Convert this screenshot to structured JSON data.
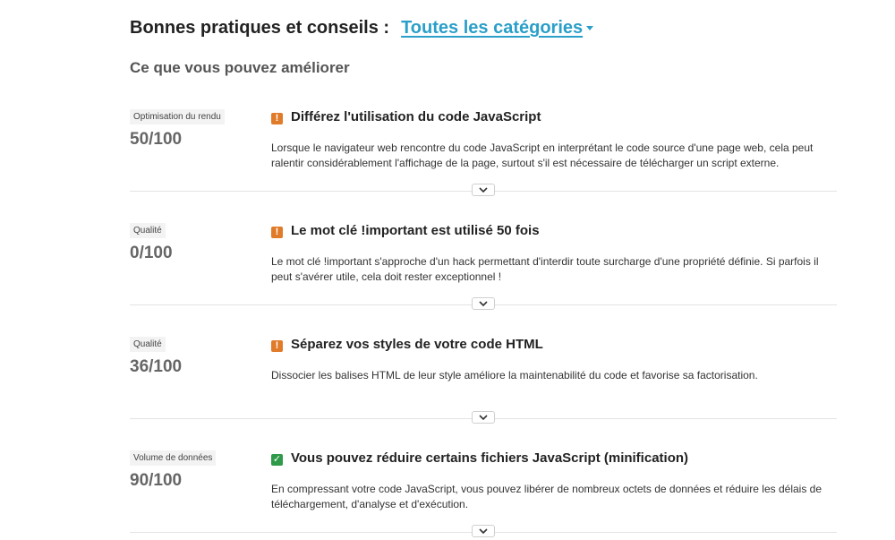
{
  "header": {
    "title": "Bonnes pratiques et conseils :",
    "filter_label": "Toutes les catégories"
  },
  "section": {
    "subtitle": "Ce que vous pouvez améliorer"
  },
  "items": [
    {
      "category": "Optimisation du rendu",
      "score": "50/100",
      "status": "warning",
      "title": "Différez l'utilisation du code JavaScript",
      "description": "Lorsque le navigateur web rencontre du code JavaScript en interprétant le code source d'une page web, cela peut ralentir considérablement l'affichage de la page, surtout s'il est nécessaire de télécharger un script externe."
    },
    {
      "category": "Qualité",
      "score": "0/100",
      "status": "warning",
      "title": "Le mot clé !important est utilisé 50 fois",
      "description": "Le mot clé !important s'approche d'un hack permettant d'interdir toute surcharge d'une propriété définie. Si parfois il peut s'avérer utile, cela doit rester exceptionnel !"
    },
    {
      "category": "Qualité",
      "score": "36/100",
      "status": "warning",
      "title": "Séparez vos styles de votre code HTML",
      "description": "Dissocier les balises HTML de leur style améliore la maintenabilité du code et favorise sa factorisation."
    },
    {
      "category": "Volume de données",
      "score": "90/100",
      "status": "ok",
      "title": "Vous pouvez réduire certains fichiers JavaScript (minification)",
      "description": "En compressant votre code JavaScript, vous pouvez libérer de nombreux octets de données et réduire les délais de téléchargement, d'analyse et d'exécution."
    }
  ],
  "colors": {
    "accent": "#2a9fc9",
    "warning": "#e07b2a",
    "ok": "#2f9a4a"
  },
  "icons": {
    "warning": "warning-icon",
    "ok": "check-icon",
    "expand": "chevron-down-icon",
    "filter": "caret-down-icon"
  }
}
